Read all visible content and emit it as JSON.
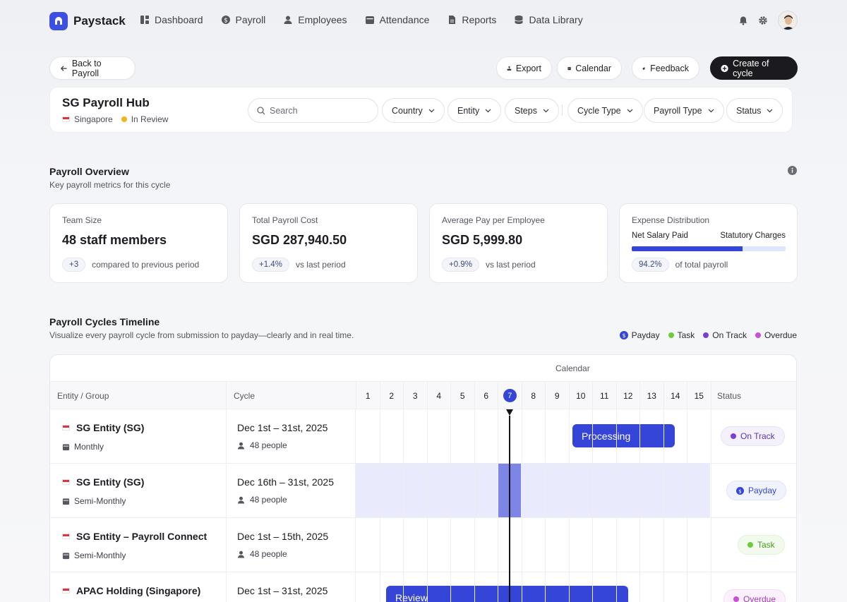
{
  "brand": {
    "name": "Paystack"
  },
  "nav": [
    {
      "label": "Dashboard",
      "icon": "dashboard-icon"
    },
    {
      "label": "Payroll",
      "icon": "dollar-icon"
    },
    {
      "label": "Employees",
      "icon": "users-icon"
    },
    {
      "label": "Attendance",
      "icon": "calendar-icon"
    },
    {
      "label": "Reports",
      "icon": "document-icon"
    },
    {
      "label": "Data Library",
      "icon": "database-icon"
    }
  ],
  "actions": {
    "back": "Back to Payroll",
    "export": "Export",
    "calendar": "Calendar",
    "feedback": "Feedback",
    "create": "Create of cycle"
  },
  "hub": {
    "title": "SG Payroll Hub",
    "country": "Singapore",
    "status": "In Review",
    "status_color": "#f2b51c",
    "search_placeholder": "Search",
    "filters": [
      "Country",
      "Entity",
      "Steps",
      "Cycle Type",
      "Payroll Type",
      "Status"
    ]
  },
  "overview": {
    "title": "Payroll Overview",
    "subtitle": "Key payroll metrics for this cycle",
    "metrics": [
      {
        "label": "Team Size",
        "value": "48 staff members",
        "chip": "+3",
        "note": "compared to previous period"
      },
      {
        "label": "Total Payroll Cost",
        "value": "SGD 287,940.50",
        "chip": "+1.4%",
        "note": "vs last period"
      },
      {
        "label": "Average Pay per Employee",
        "value": "SGD 5,999.80",
        "chip": "+0.9%",
        "note": "vs last period"
      }
    ],
    "distribution": {
      "label": "Expense Distribution",
      "left": "Net Salary Paid",
      "right": "Statutory Charges",
      "percent": 0.72,
      "chip": "94.2%",
      "note": "of total payroll"
    }
  },
  "timeline": {
    "title": "Payroll Cycles Timeline",
    "subtitle": "Visualize every payroll cycle from submission to payday—clearly and in real time.",
    "legend": [
      {
        "label": "Payday",
        "color": "#3545d8"
      },
      {
        "label": "Task",
        "color": "#6fcb3a"
      },
      {
        "label": "On Track",
        "color": "#7b3fd6"
      },
      {
        "label": "Overdue",
        "color": "#c94fd8"
      }
    ],
    "calendar_label": "Calendar",
    "col_entity": "Entity / Group",
    "col_cycle": "Cycle",
    "col_status": "Status",
    "days": [
      "1",
      "2",
      "3",
      "4",
      "5",
      "6",
      "7",
      "8",
      "9",
      "10",
      "11",
      "12",
      "13",
      "14",
      "15"
    ],
    "today": "7",
    "rows": [
      {
        "entity": "SG Entity (SG)",
        "freq": "Monthly",
        "cycle": "Dec 1st – 31st, 2025",
        "people": "48 people",
        "bar": "Processing",
        "status": "On Track"
      },
      {
        "entity": "SG Entity (SG)",
        "freq": "Semi-Monthly",
        "cycle": "Dec 16th – 31st, 2025",
        "people": "48 people",
        "bar": "",
        "status": "Payday"
      },
      {
        "entity": "SG Entity – Payroll Connect",
        "freq": "Semi-Monthly",
        "cycle": "Dec 1st – 15th, 2025",
        "people": "48 people",
        "bar": "",
        "status": "Task"
      },
      {
        "entity": "APAC Holding (Singapore)",
        "freq": "",
        "cycle": "Dec 1st – 31st, 2025",
        "people": "",
        "bar": "Review",
        "status": "Overdue"
      }
    ]
  }
}
